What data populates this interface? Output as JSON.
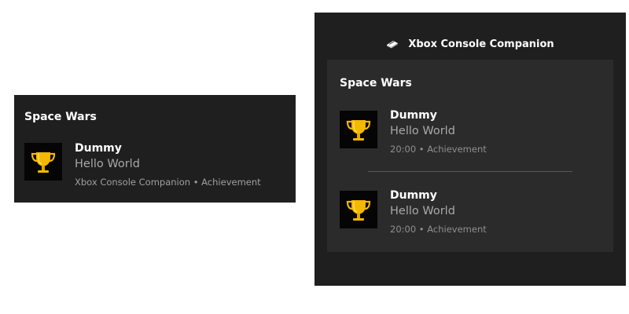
{
  "toast": {
    "title": "Space Wars",
    "notification": {
      "heading": "Dummy",
      "body": "Hello World",
      "meta": "Xbox Console Companion • Achievement",
      "icon": "trophy-icon"
    }
  },
  "action_center": {
    "app_name": "Xbox Console Companion",
    "app_icon": "xbox-console-icon",
    "group_title": "Space Wars",
    "notifications": [
      {
        "heading": "Dummy",
        "body": "Hello World",
        "meta": "20:00 • Achievement",
        "icon": "trophy-icon"
      },
      {
        "heading": "Dummy",
        "body": "Hello World",
        "meta": "20:00 • Achievement",
        "icon": "trophy-icon"
      }
    ]
  },
  "colors": {
    "panel_bg": "#1f1f1f",
    "group_bg": "#2b2b2b",
    "trophy_gold": "#f5b800",
    "text_primary": "#ffffff",
    "text_secondary": "#a8a8a8"
  }
}
